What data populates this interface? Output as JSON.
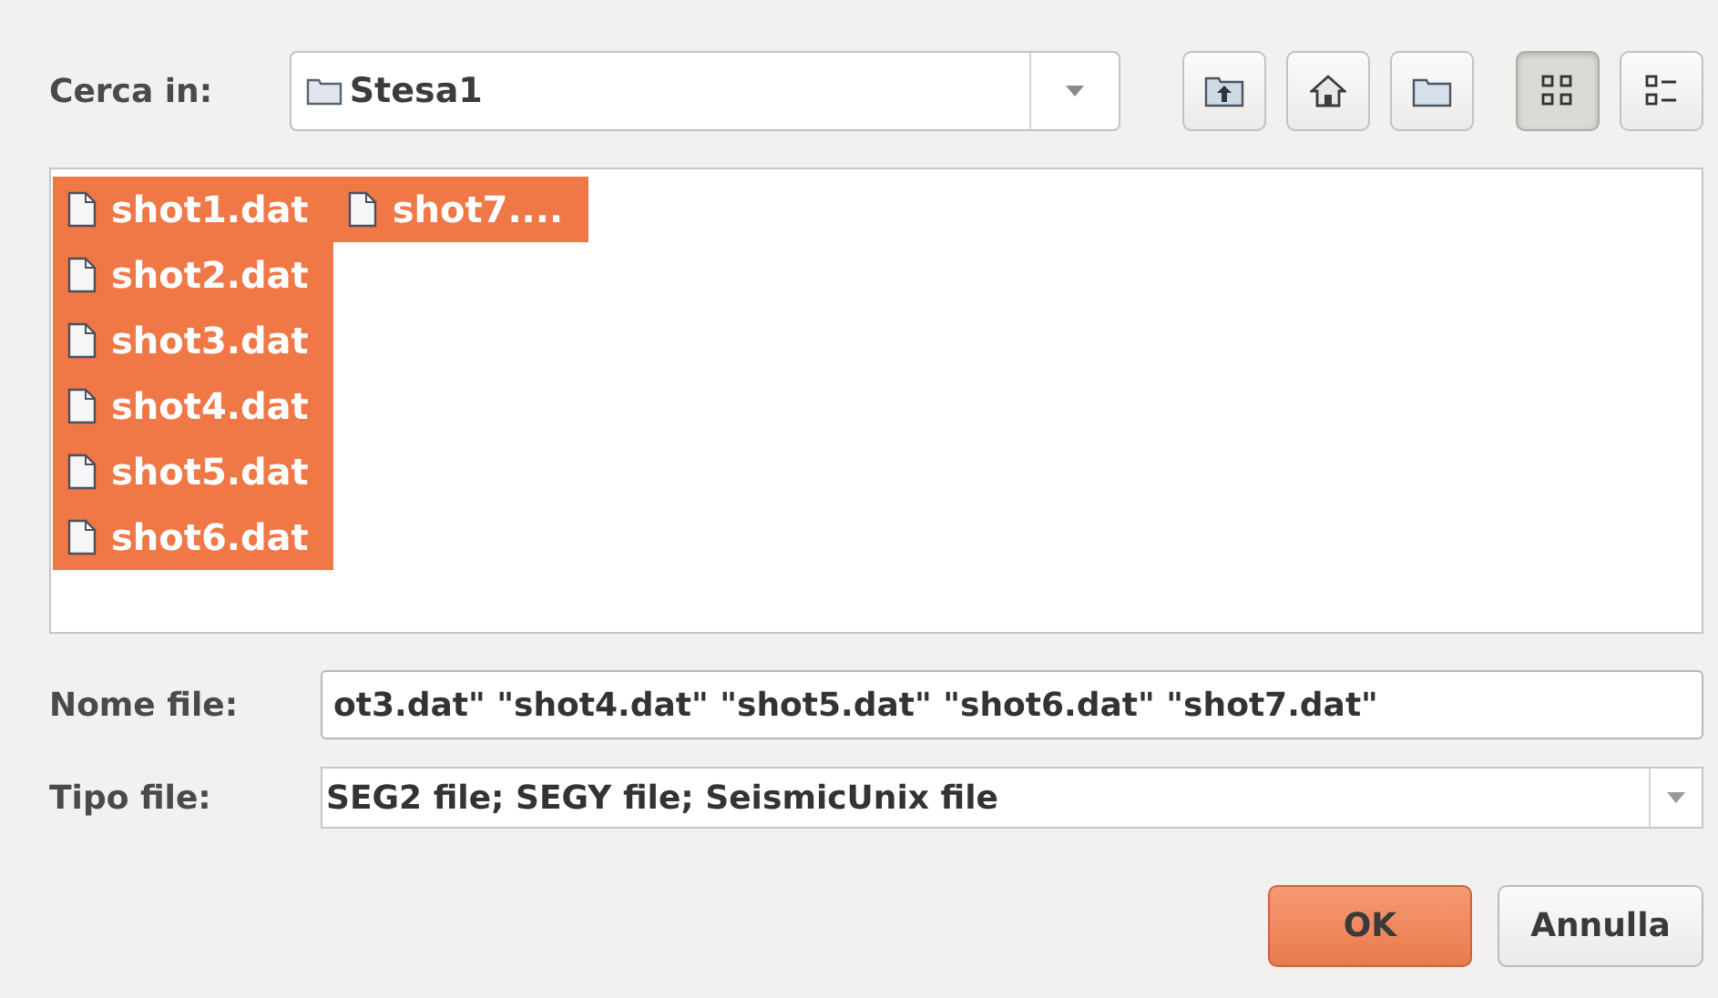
{
  "look_in": {
    "label": "Cerca in:",
    "value": "Stesa1"
  },
  "toolbar": [
    {
      "kind": "up",
      "selected": false
    },
    {
      "kind": "home",
      "selected": false
    },
    {
      "kind": "newfolder",
      "selected": false
    },
    {
      "kind": "list",
      "selected": true
    },
    {
      "kind": "details",
      "selected": false
    }
  ],
  "files": [
    {
      "name": "shot1.dat",
      "selected": true
    },
    {
      "name": "shot2.dat",
      "selected": true
    },
    {
      "name": "shot3.dat",
      "selected": true
    },
    {
      "name": "shot4.dat",
      "selected": true
    },
    {
      "name": "shot5.dat",
      "selected": true
    },
    {
      "name": "shot6.dat",
      "selected": true
    },
    {
      "name": "shot7....",
      "selected": true
    }
  ],
  "file_name": {
    "label": "Nome file:",
    "value": "ot3.dat\" \"shot4.dat\" \"shot5.dat\" \"shot6.dat\" \"shot7.dat\""
  },
  "file_type": {
    "label": "Tipo file:",
    "value": "SEG2 file; SEGY file; SeismicUnix file"
  },
  "buttons": [
    {
      "label": "OK",
      "kind": "primary"
    },
    {
      "label": "Annulla",
      "kind": "secondary"
    }
  ]
}
